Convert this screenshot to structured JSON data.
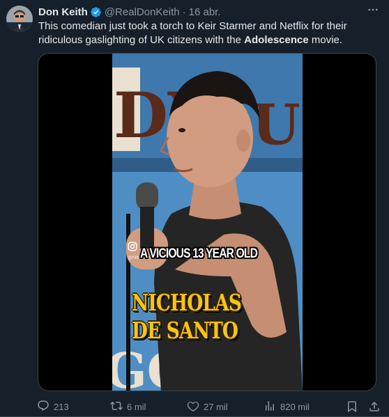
{
  "tweet": {
    "author": {
      "display_name": "Don Keith",
      "handle": "@RealDonKeith",
      "verified_icon": "verified-badge-icon",
      "avatar_icon": "avatar"
    },
    "separator": "·",
    "timestamp": "16 abr.",
    "more_icon": "more-icon",
    "text_before": "This comedian just took a torch to Keir Starmer and Netflix for their ridiculous gaslighting of UK citizens with the ",
    "text_bold": "Adolescence",
    "text_after": " movie.",
    "media": {
      "caption_line1": "A VICIOUS 13 YEAR OLD",
      "caption_line2": "NICHOLAS",
      "caption_line3": "DE SANTO",
      "watermark": "@NICKDESANTO"
    },
    "actions": {
      "replies": "213",
      "retweets": "6 mil",
      "likes": "27 mil",
      "views": "820 mil"
    }
  },
  "colors": {
    "background": "#15202b",
    "text_primary": "#e7e9ea",
    "text_secondary": "#8b98a5",
    "verified": "#1d9bf0",
    "caption_yellow": "#f5c518"
  }
}
